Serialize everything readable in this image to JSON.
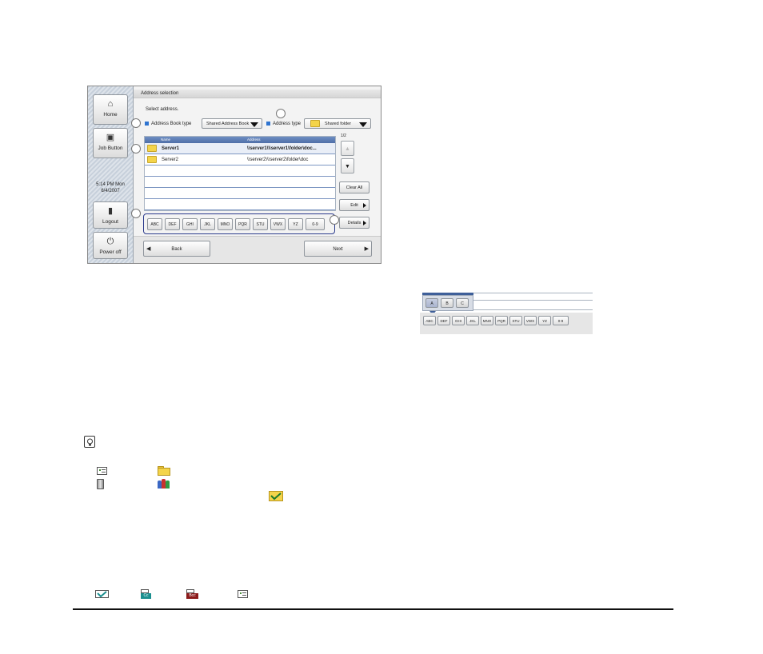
{
  "sidebar": {
    "home_label": "Home",
    "job_button_label": "Job Button",
    "clock_time": "5:14 PM  Mon",
    "clock_date": "6/4/2007",
    "logout_label": "Logout",
    "power_off_label": "Power off"
  },
  "screen": {
    "title": "Address selection",
    "instruction": "Select address.",
    "address_book_type_label": "Address Book type",
    "address_book_type_value": "Shared Address Book",
    "address_type_label": "Address type",
    "address_type_value": "Shared folder",
    "page_indicator": "1/2",
    "columns": {
      "name": "Name",
      "address": "Address"
    },
    "rows": [
      {
        "name": "Server1",
        "address": "\\\\server1\\\\\\server1\\folder\\doc..."
      },
      {
        "name": "Server2",
        "address": "\\\\server2\\\\\\server2\\folder\\doc"
      }
    ],
    "clear_all_label": "Clear All",
    "edit_label": "Edit",
    "details_label": "Details",
    "back_label": "Back",
    "next_label": "Next",
    "index_keys": [
      "ABC",
      "DEF",
      "GHI",
      "JKL",
      "MNO",
      "PQR",
      "STU",
      "VWX",
      "YZ",
      "0-9"
    ]
  },
  "zoom": {
    "sub_keys": [
      "A",
      "B",
      "C"
    ],
    "index_keys": [
      "ABC",
      "DEF",
      "GHI",
      "JKL",
      "MNO",
      "PQR",
      "STU",
      "VWX",
      "YZ",
      "0-9"
    ]
  },
  "icons": {
    "hint": "lightbulb-icon",
    "legend_row1": [
      "address-card-icon",
      "folder-icon"
    ],
    "legend_row2": [
      "server-icon",
      "group-icon"
    ],
    "checked_folder": "checked-folder-icon",
    "bottom_row": [
      "checkmark-icon",
      "cc-icon",
      "bcc-icon",
      "address-card-icon"
    ]
  },
  "colors": {
    "accent_blue": "#2f74d0",
    "index_border": "#2a3a8c",
    "folder_yellow": "#f4d44a"
  }
}
